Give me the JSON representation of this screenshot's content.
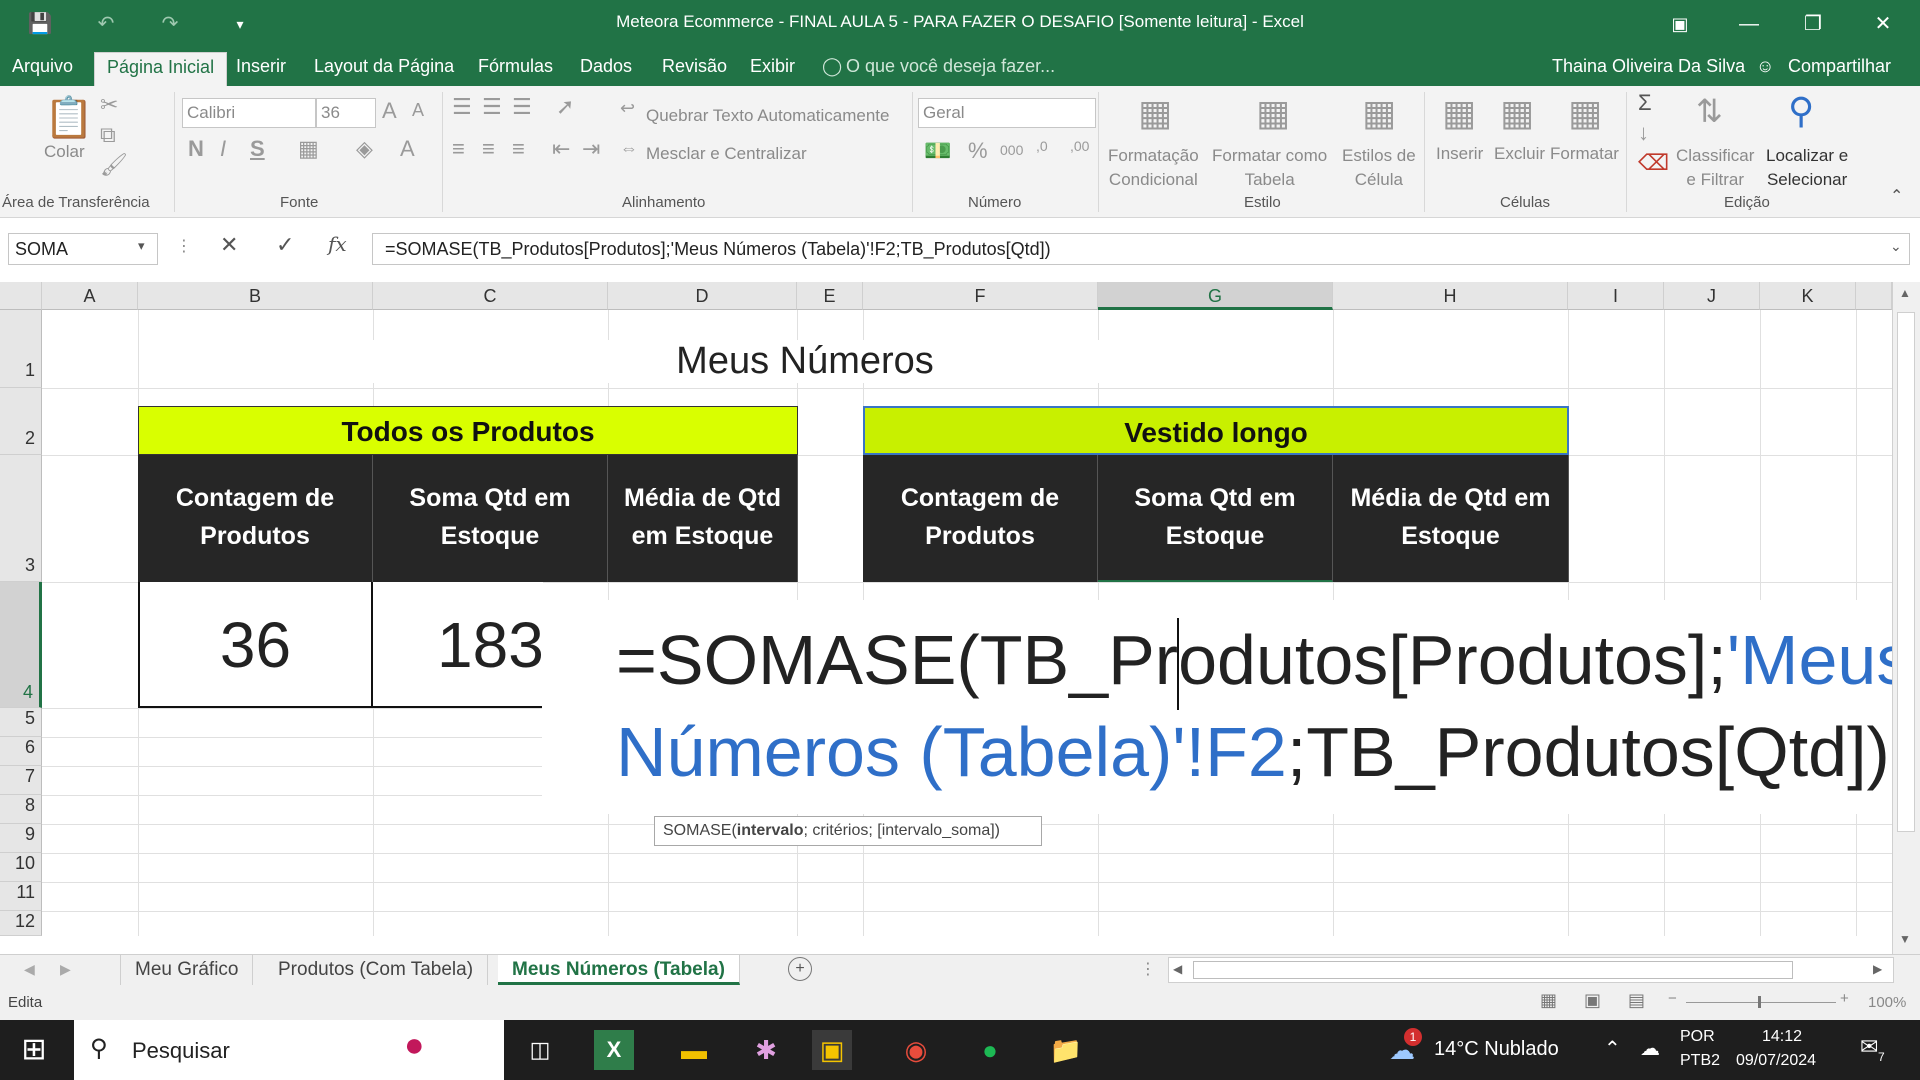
{
  "window": {
    "title": "Meteora Ecommerce - FINAL AULA 5 - PARA FAZER O DESAFIO  [Somente leitura] - Excel"
  },
  "menu": {
    "tabs": [
      "Arquivo",
      "Página Inicial",
      "Inserir",
      "Layout da Página",
      "Fórmulas",
      "Dados",
      "Revisão",
      "Exibir"
    ],
    "tell_me": "O que você deseja fazer...",
    "user": "Thaina Oliveira Da Silva",
    "share": "Compartilhar"
  },
  "ribbon": {
    "paste": "Colar",
    "font_name": "Calibri",
    "font_size": "36",
    "wrap": "Quebrar Texto Automaticamente",
    "merge": "Mesclar e Centralizar",
    "number_format": "Geral",
    "cond_format": "Formatação\nCondicional",
    "format_table": "Formatar como\nTabela",
    "cell_styles": "Estilos de\nCélula",
    "insert": "Inserir",
    "delete": "Excluir",
    "format": "Formatar",
    "sort": "Classificar\ne Filtrar",
    "find": "Localizar e\nSelecionar",
    "groups": {
      "clipboard": "Área de Transferência",
      "font": "Fonte",
      "alignment": "Alinhamento",
      "number": "Número",
      "style": "Estilo",
      "cells": "Células",
      "editing": "Edição"
    }
  },
  "formula_bar": {
    "name_box": "SOMA",
    "formula": "=SOMASE(TB_Produtos[Produtos];'Meus Números (Tabela)'!F2;TB_Produtos[Qtd])"
  },
  "grid": {
    "columns": [
      "A",
      "B",
      "C",
      "D",
      "E",
      "F",
      "G",
      "H",
      "I",
      "J",
      "K"
    ],
    "rows": [
      "1",
      "2",
      "3",
      "4",
      "5",
      "6",
      "7",
      "8",
      "9",
      "10",
      "11",
      "12"
    ],
    "title": "Meus Números",
    "left_header": "Todos os Produtos",
    "right_header": "Vestido longo",
    "col_labels": [
      "Contagem de Produtos",
      "Soma Qtd em Estoque",
      "Média de Qtd em Estoque"
    ],
    "values": {
      "count": "36",
      "sum": "183"
    },
    "editor": {
      "part1": "=SOMASE(TB_Produtos[Produtos];",
      "part2": "'Meus Números (Tabela)'!F2",
      "part3": ";TB_Produtos[Qtd])"
    },
    "tooltip": {
      "fn": "SOMASE(",
      "bold": "intervalo",
      "rest": "; critérios; [intervalo_soma])"
    }
  },
  "sheets": [
    "Meu Gráfico",
    "Produtos (Com Tabela)",
    "Meus Números (Tabela)"
  ],
  "status": {
    "mode": "Edita",
    "zoom": "100%"
  },
  "taskbar": {
    "search": "Pesquisar",
    "weather": "14°C  Nublado",
    "lang1": "POR",
    "lang2": "PTB2",
    "time": "14:12",
    "date": "09/07/2024",
    "notif": "7",
    "weather_badge": "1"
  }
}
